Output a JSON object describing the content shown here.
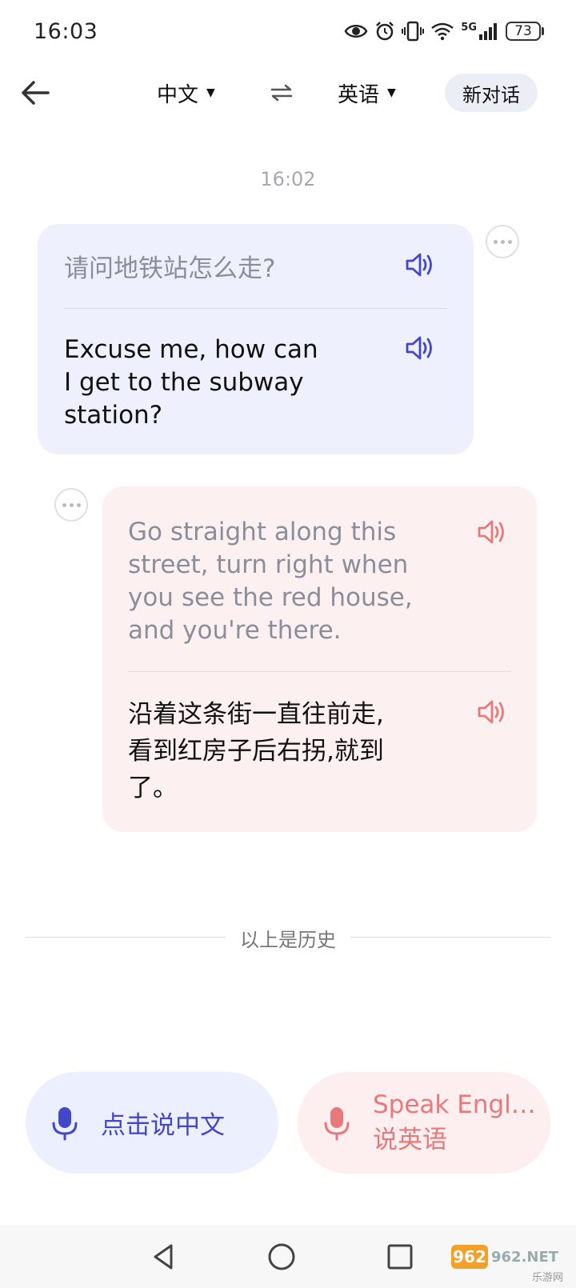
{
  "status_bar": {
    "time": "16:03",
    "battery": "73",
    "network": "5G"
  },
  "header": {
    "source_lang": "中文",
    "target_lang": "英语",
    "new_chat_label": "新对话"
  },
  "conversation": {
    "timestamp": "16:02",
    "messages": [
      {
        "side": "me",
        "source_text": "请问地铁站怎么走?",
        "translation_lines": [
          "Excuse me, how can",
          "I get to the subway",
          "station?"
        ]
      },
      {
        "side": "other",
        "source_lines": [
          "Go straight along this",
          "street, turn right when",
          "you see the red house,",
          "and you're there."
        ],
        "translation_lines": [
          "沿着这条街一直往前走,",
          "看到红房子后右拐,就到",
          "了。"
        ]
      }
    ],
    "history_label": "以上是历史"
  },
  "speak_buttons": {
    "chinese_label": "点击说中文",
    "english_label_1": "Speak English",
    "english_label_2": "说英语"
  },
  "watermark": {
    "text": "962.NET",
    "subtext": "乐游网"
  },
  "colors": {
    "me_bubble": "#eef0fd",
    "other_bubble": "#fdf0f1",
    "accent_blue": "#4447c8",
    "accent_red": "#e7797b"
  },
  "icons": [
    "eye-icon",
    "alarm-icon",
    "vibrate-icon",
    "wifi-icon",
    "signal-icon",
    "battery-icon",
    "back-arrow-icon",
    "swap-icon",
    "speaker-icon",
    "more-icon",
    "mic-icon",
    "nav-back-icon",
    "nav-home-icon",
    "nav-recents-icon"
  ]
}
